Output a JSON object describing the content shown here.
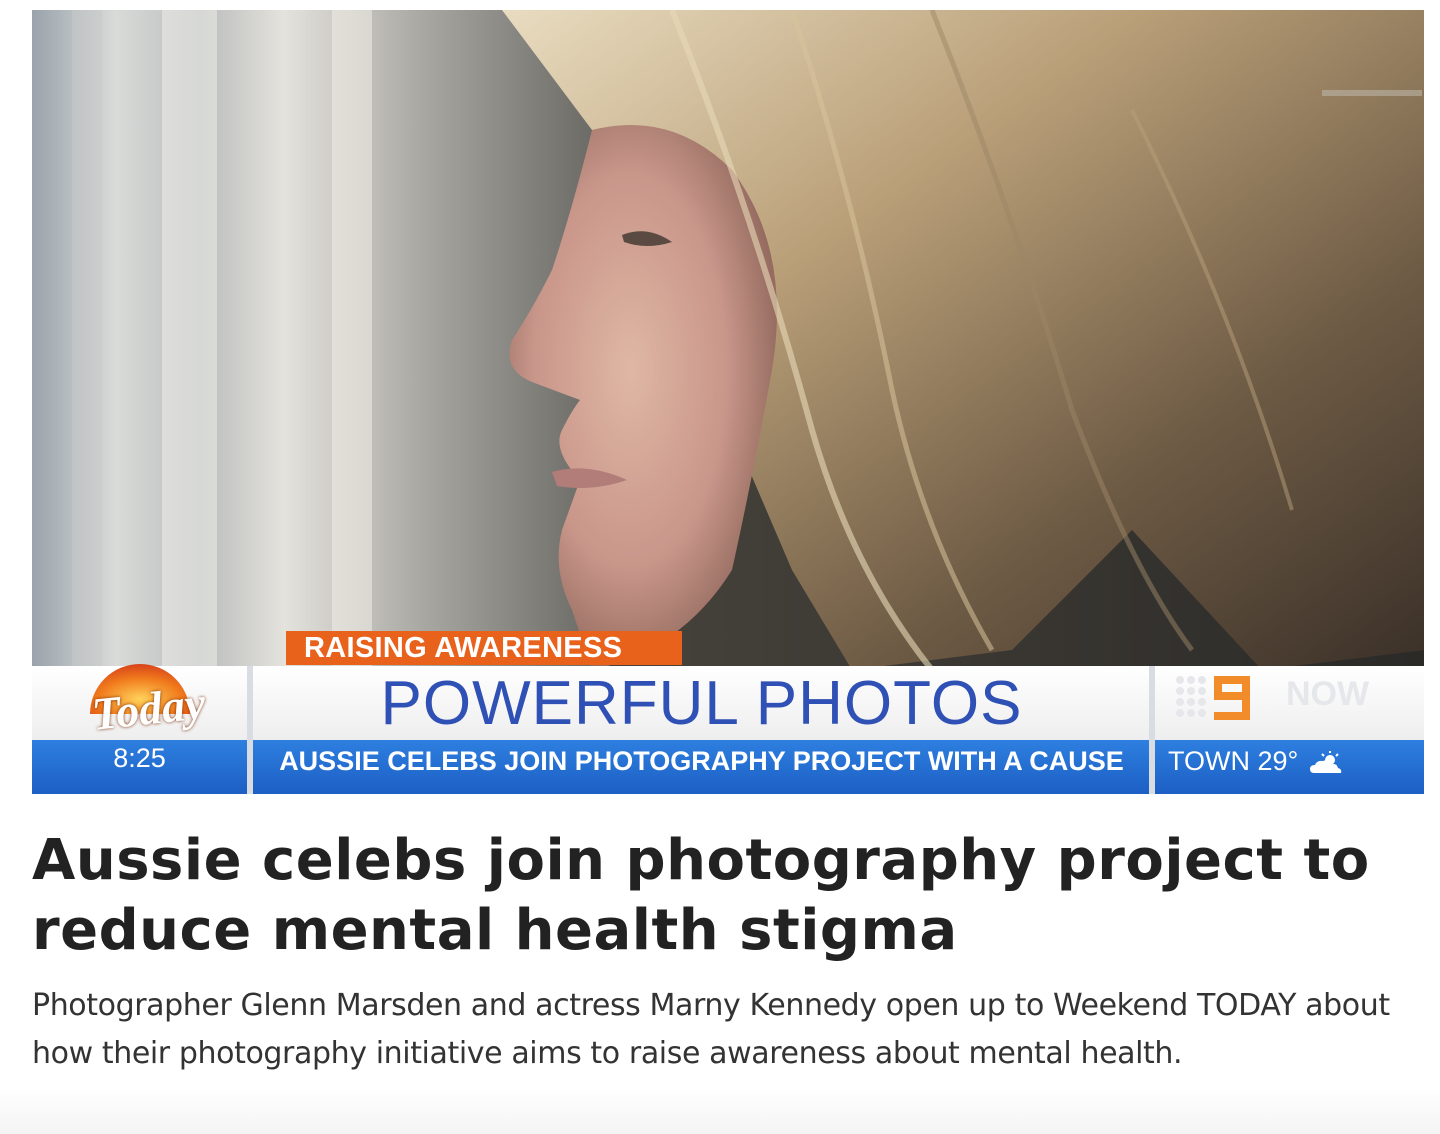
{
  "video": {
    "kicker": "RAISING AWARENESS",
    "headline": "POWERFUL PHOTOS",
    "ticker": "AUSSIE CELEBS JOIN PHOTOGRAPHY PROJECT WITH A CAUSE",
    "show_logo": "Today",
    "show_time": "8:25",
    "network_tag": "NOW",
    "weather": "TOWN 29°",
    "weather_icon": "partly-cloudy-icon"
  },
  "article": {
    "title": "Aussie celebs join photography project to reduce mental health stigma",
    "summary": "Photographer Glenn Marsden and actress Marny Kennedy open up to Weekend TODAY about how their photography initiative aims to raise awareness about mental health."
  },
  "colors": {
    "kicker_bg": "#e8621b",
    "headline_text": "#2f50b5",
    "ticker_bg": "#1d5fc4",
    "title_text": "#222222"
  }
}
